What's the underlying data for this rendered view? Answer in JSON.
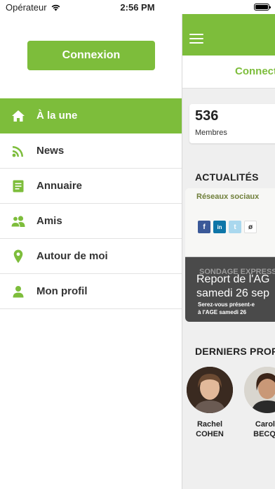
{
  "status_bar": {
    "carrier": "Opérateur",
    "time": "2:56 PM"
  },
  "menu": {
    "login_button": "Connexion",
    "items": [
      {
        "label": "À la une",
        "icon": "home-icon",
        "active": true
      },
      {
        "label": "News",
        "icon": "rss-icon",
        "active": false
      },
      {
        "label": "Annuaire",
        "icon": "directory-icon",
        "active": false
      },
      {
        "label": "Amis",
        "icon": "friends-icon",
        "active": false
      },
      {
        "label": "Autour de moi",
        "icon": "location-pin-icon",
        "active": false
      },
      {
        "label": "Mon profil",
        "icon": "user-icon",
        "active": false
      }
    ]
  },
  "panel": {
    "connect_text": "Connect",
    "members": {
      "count": "536",
      "label": "Membres"
    },
    "news_section_title": "ACTUALITÉS",
    "news_card": {
      "image_text": "Réseaux sociaux",
      "sondage_text": "SONDAGE EXPRESS",
      "headline_line1": "Report de l'AG",
      "headline_line2": "samedi 26 sep",
      "subtext_line1": "Serez-vous présent-e",
      "subtext_line2": "à l'AGE samedi 26"
    },
    "profiles_section_title": "DERNIERS PROF",
    "profiles": [
      {
        "first": "Rachel",
        "last": "COHEN"
      },
      {
        "first": "Carole",
        "last": "BECQU"
      }
    ]
  },
  "colors": {
    "accent": "#7dbd3b",
    "menu_icon": "#7dbd3b",
    "panel_bg": "#efefef"
  }
}
